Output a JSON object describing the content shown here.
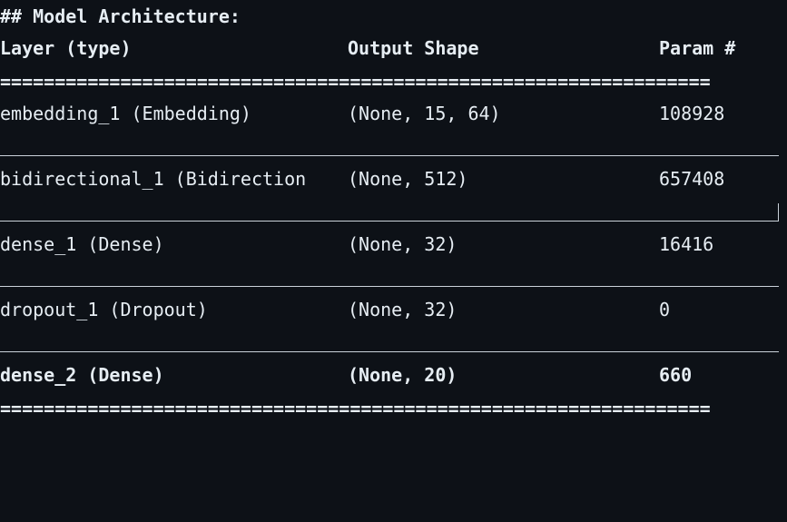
{
  "heading": "## Model Architecture:",
  "header": {
    "layer": "Layer (type)",
    "output": "Output Shape",
    "params": "Param #"
  },
  "rule_eq": "=================================================================",
  "rows": [
    {
      "layer": "embedding_1 (Embedding)",
      "output": "(None, 15, 64)",
      "params": "108928"
    },
    {
      "layer": "bidirectional_1 (Bidirection",
      "output": "(None, 512)",
      "params": "657408"
    },
    {
      "layer": "dense_1 (Dense)",
      "output": "(None, 32)",
      "params": "16416"
    },
    {
      "layer": "dropout_1 (Dropout)",
      "output": "(None, 32)",
      "params": "0"
    },
    {
      "layer": "dense_2 (Dense)",
      "output": "(None, 20)",
      "params": "660"
    }
  ]
}
